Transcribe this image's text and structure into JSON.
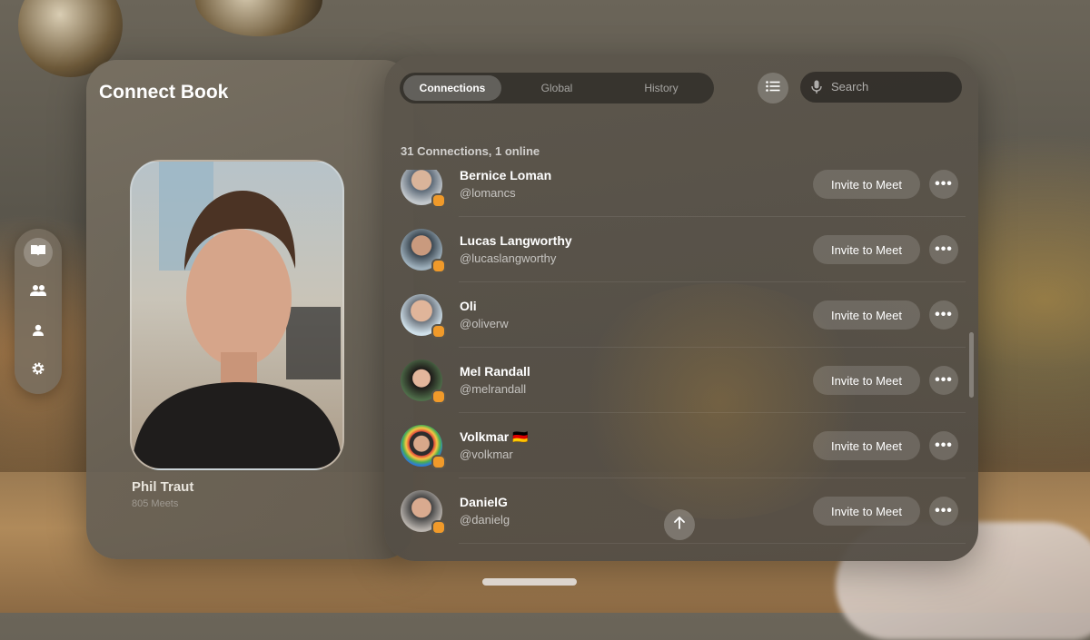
{
  "app": {
    "title": "Connect Book"
  },
  "profile": {
    "name": "Phil Traut",
    "meets": "805 Meets"
  },
  "tabs": [
    {
      "label": "Connections",
      "active": true
    },
    {
      "label": "Global",
      "active": false
    },
    {
      "label": "History",
      "active": false
    }
  ],
  "search": {
    "placeholder": "Search"
  },
  "summary": "31 Connections, 1 online",
  "connections": [
    {
      "name": "Bernice Loman",
      "handle": "@lomancs",
      "status": "away"
    },
    {
      "name": "Lucas Langworthy",
      "handle": "@lucaslangworthy",
      "status": "away"
    },
    {
      "name": "Oli",
      "handle": "@oliverw",
      "status": "away"
    },
    {
      "name": "Mel Randall",
      "handle": "@melrandall",
      "status": "away"
    },
    {
      "name": "Volkmar 🇩🇪",
      "handle": "@volkmar",
      "status": "away"
    },
    {
      "name": "DanielG",
      "handle": "@danielg",
      "status": "away"
    }
  ],
  "actions": {
    "invite_label": "Invite to Meet",
    "more_label": "•••"
  },
  "sidebar": {
    "items": [
      {
        "icon": "book-icon",
        "active": true
      },
      {
        "icon": "people-icon",
        "active": false
      },
      {
        "icon": "person-icon",
        "active": false
      },
      {
        "icon": "gear-icon",
        "active": false
      }
    ]
  },
  "colors": {
    "status_away": "#f09a2a",
    "accent": "#ffffff"
  }
}
